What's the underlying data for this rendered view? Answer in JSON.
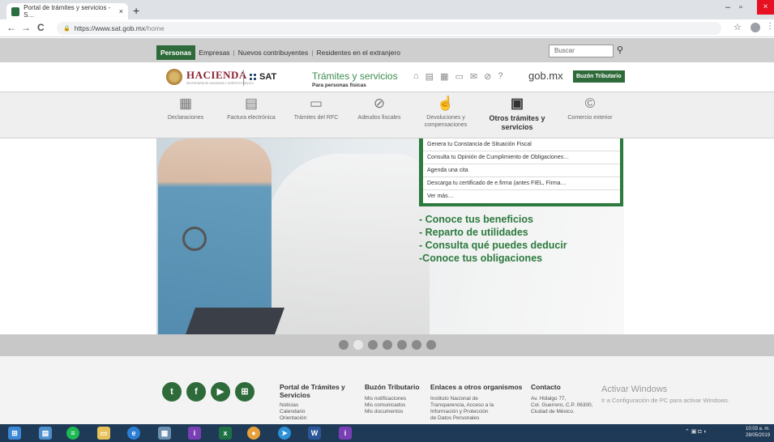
{
  "browser": {
    "tab_title": "Portal de trámites y servicios - S…",
    "tab_close": "×",
    "new_tab": "+",
    "back": "←",
    "forward": "→",
    "reload": "C",
    "url_host": "https://www.sat.gob.mx",
    "url_path": "/home",
    "star": "☆",
    "minimize": "–",
    "restore": "▫",
    "close": "×"
  },
  "topnav": {
    "personas": "Personas",
    "empresas": "Empresas",
    "nuevos": "Nuevos contribuyentes",
    "residentes": "Residentes en el extranjero",
    "sep": "|",
    "search_placeholder": "Buscar"
  },
  "header": {
    "hacienda": "HACIENDA",
    "hacienda_sub": "SECRETARÍA DE HACIENDA Y CRÉDITO PÚBLICO",
    "sat": "SAT",
    "tramites": "Trámites y servicios",
    "personas_fisicas": "Para personas físicas",
    "gobmx": "gob.mx",
    "buzon": "Buzón Tributario"
  },
  "services": [
    {
      "label": "Declaraciones",
      "icon": "▦"
    },
    {
      "label": "Factura electrónica",
      "icon": "▤"
    },
    {
      "label": "Trámites del RFC",
      "icon": "▭"
    },
    {
      "label": "Adeudos fiscales",
      "icon": "⊘"
    },
    {
      "label": "Devoluciones y compensaciones",
      "icon": "☝"
    },
    {
      "label": "Otros trámites y servicios",
      "icon": "▣"
    },
    {
      "label": "Comercio exterior",
      "icon": "©"
    }
  ],
  "dropdown": [
    "Genera tu Constancia de Situación Fiscal",
    "Consulta tu Opinión de Cumplimiento de Obligaciones…",
    "Agenda una cita",
    "Descarga tu certificado de e.firma (antes FIEL, Firma…",
    "Ver más…"
  ],
  "hero": {
    "line1": "- Conoce tus beneficios",
    "line2": "- Reparto de utilidades",
    "line3": "- Consulta qué puedes deducir",
    "line4": "-Conoce tus obligaciones"
  },
  "footer": {
    "col1_title": "Portal de Trámites y Servicios",
    "col1_items": [
      "Noticias",
      "Calendario",
      "Orientación"
    ],
    "col2_title": "Buzón Tributario",
    "col2_items": [
      "Mis notificaciones",
      "Mis comunicados",
      "Mis documentos"
    ],
    "col3_title": "Enlaces a otros organismos",
    "col3_items": [
      "Instituto Nacional de",
      "Transparencia, Acceso a la",
      "Información y Protección",
      "de Datos Personales"
    ],
    "col4_title": "Contacto",
    "col4_items": [
      "Av. Hidalgo 77,",
      "Col. Guerrero, C.P. 06300,",
      "Ciudad de México."
    ],
    "activar": "Activar Windows",
    "activar_sub": "Ir a Configuración de PC para activar Windows."
  },
  "taskbar": {
    "clock_time": "10:03 a. m.",
    "clock_date": "28/05/2019"
  }
}
